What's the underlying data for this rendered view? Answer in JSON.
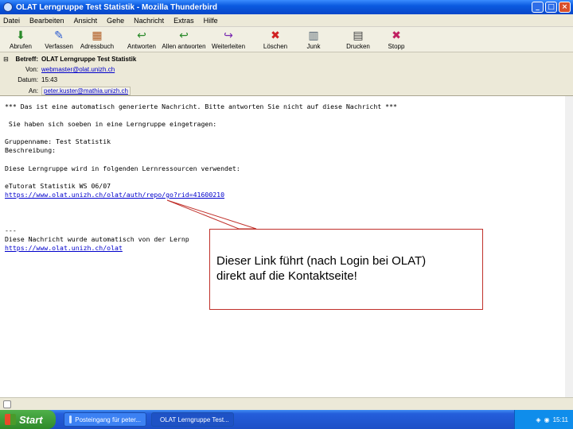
{
  "window": {
    "title": "OLAT Lerngruppe Test Statistik - Mozilla Thunderbird",
    "controls": [
      "_",
      "□",
      "×"
    ]
  },
  "menu": [
    "Datei",
    "Bearbeiten",
    "Ansicht",
    "Gehe",
    "Nachricht",
    "Extras",
    "Hilfe"
  ],
  "toolbar": [
    {
      "label": "Abrufen",
      "icon": "download-icon",
      "glyph": "⬇",
      "color": "#2a8a2a"
    },
    {
      "label": "Verfassen",
      "icon": "compose-icon",
      "glyph": "✎",
      "color": "#2a5ad0"
    },
    {
      "label": "Adressbuch",
      "icon": "addressbook-icon",
      "glyph": "📕",
      "color": "#b05a20"
    },
    {
      "label": "Antworten",
      "icon": "reply-icon",
      "glyph": "↩",
      "color": "#2a8a2a"
    },
    {
      "label": "Allen antworten",
      "icon": "reply-all-icon",
      "glyph": "↩",
      "color": "#2a8a2a"
    },
    {
      "label": "Weiterleiten",
      "icon": "forward-icon",
      "glyph": "↪",
      "color": "#7a2ab0"
    },
    {
      "label": "Löschen",
      "icon": "delete-icon",
      "glyph": "✖",
      "color": "#d02020"
    },
    {
      "label": "Junk",
      "icon": "junk-icon",
      "glyph": "🗑",
      "color": "#506070"
    },
    {
      "label": "Drucken",
      "icon": "print-icon",
      "glyph": "🖶",
      "color": "#404040"
    },
    {
      "label": "Stopp",
      "icon": "stop-icon",
      "glyph": "✖",
      "color": "#c02060"
    }
  ],
  "header": {
    "subject_label": "Betreff:",
    "subject": "OLAT Lerngruppe Test Statistik",
    "from_label": "Von:",
    "from": "webmaster@olat.unizh.ch",
    "date_label": "Datum:",
    "date": "15:43",
    "to_label": "An:",
    "to": "peter.kuster@mathia.unizh.ch"
  },
  "body": {
    "line1": "*** Das ist eine automatisch generierte Nachricht. Bitte antworten Sie nicht auf diese Nachricht ***",
    "line2": " Sie haben sich soeben in eine Lerngruppe eingetragen:",
    "line3": "Gruppenname: Test Statistik",
    "line4": "Beschreibung:",
    "line5": "Diese Lerngruppe wird in folgenden Lernressourcen verwendet:",
    "line6": "eTutorat Statistik WS 06/07",
    "link1": "https://www.olat.unizh.ch/olat/auth/repo/go?rid=41600210",
    "line7": "---",
    "line8": "Diese Nachricht wurde automatisch von der Lernp",
    "link2": "https://www.olat.unizh.ch/olat"
  },
  "callout": {
    "line1": "Dieser Link führt (nach Login bei OLAT)",
    "line2": "direkt auf die Kontaktseite!"
  },
  "taskbar": {
    "start": "Start",
    "tasks": [
      "Posteingang für peter...",
      "OLAT Lerngruppe Test..."
    ],
    "clock": "15:11"
  }
}
